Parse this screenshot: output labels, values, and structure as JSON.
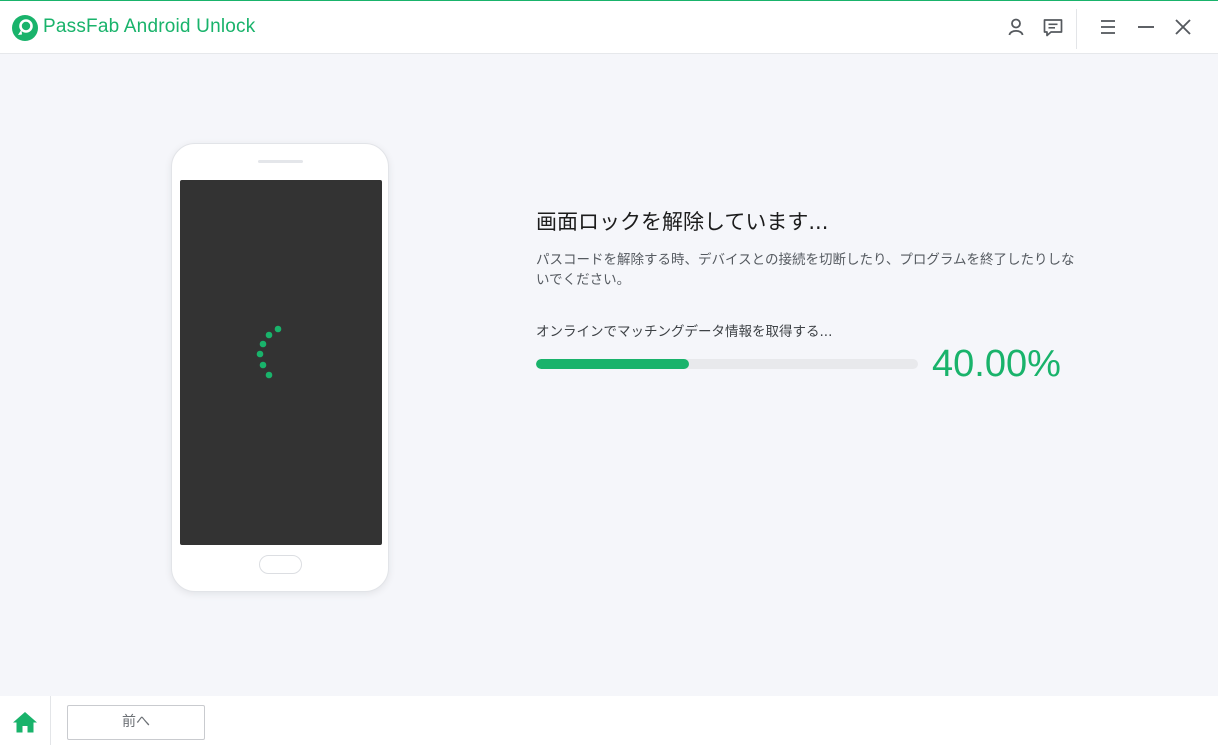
{
  "window": {
    "title": "PassFab Android Unlock",
    "brand_color": "#19b36b",
    "icons": [
      "logo-icon",
      "account-icon",
      "feedback-icon",
      "menu-icon",
      "minimize-icon",
      "close-icon"
    ]
  },
  "main": {
    "status_title": "画面ロックを解除しています...",
    "status_description": "パスコードを解除する時、デバイスとの接続を切断したり、プログラムを終了したりしないでください。",
    "progress": {
      "label": "オンラインでマッチングデータ情報を取得する...",
      "fraction": 0.4,
      "percent_text": "40.00%"
    },
    "phone_screen_color": "#333333"
  },
  "footer": {
    "home_icon": "home-icon",
    "back_label": "前へ"
  }
}
